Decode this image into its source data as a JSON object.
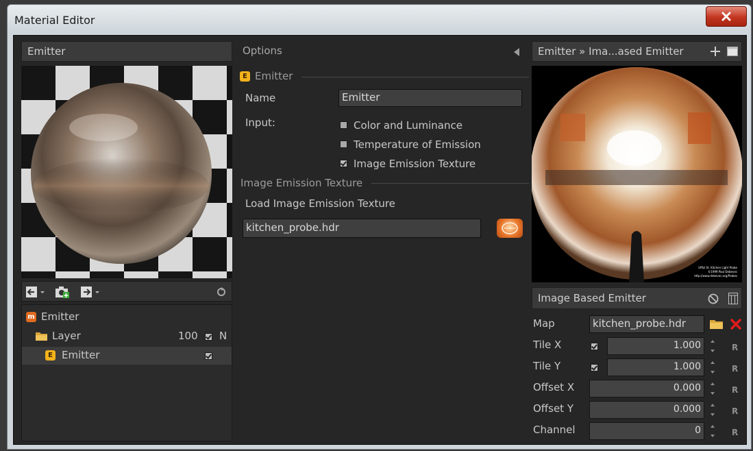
{
  "window": {
    "title": "Material Editor"
  },
  "left": {
    "header": "Emitter",
    "tree": [
      {
        "icon": "material-icon",
        "badge": "m",
        "label": "Emitter"
      },
      {
        "icon": "folder-icon",
        "label": "Layer",
        "value": "100",
        "checked": true,
        "flag": "N"
      },
      {
        "icon": "emitter-icon",
        "badge": "E",
        "label": "Emitter",
        "checked": true
      }
    ]
  },
  "options": {
    "header": "Options",
    "section_emitter": "Emitter",
    "name_label": "Name",
    "name_value": "Emitter",
    "input_label": "Input:",
    "inputs": [
      {
        "label": "Color and Luminance",
        "checked": false
      },
      {
        "label": "Temperature of Emission",
        "checked": false
      },
      {
        "label": "Image Emission Texture",
        "checked": true
      }
    ],
    "section_texture": "Image Emission Texture",
    "load_label": "Load Image Emission Texture",
    "texture_value": "kitchen_probe.hdr"
  },
  "right": {
    "breadcrumb": "Emitter » Ima...ased Emitter",
    "preview_caption": [
      "Uffizi St. Kitchen Light Probe",
      "©1999 Paul Debevec",
      "http://www.debevec.org/Probes"
    ],
    "ibe_header": "Image Based Emitter",
    "props": {
      "map_label": "Map",
      "map_value": "kitchen_probe.hdr",
      "tilex_label": "Tile X",
      "tilex_value": "1.000",
      "tiley_label": "Tile Y",
      "tiley_value": "1.000",
      "offsetx_label": "Offset X",
      "offsetx_value": "0.000",
      "offsety_label": "Offset Y",
      "offsety_value": "0.000",
      "channel_label": "Channel",
      "channel_value": "0",
      "reset_label": "R"
    }
  },
  "colors": {
    "panel_bg": "#262626",
    "badge_orange": "#f3b21b",
    "badge_material": "#e06a1f",
    "close_red": "#c2351f",
    "delete_red": "#e01b1b"
  }
}
